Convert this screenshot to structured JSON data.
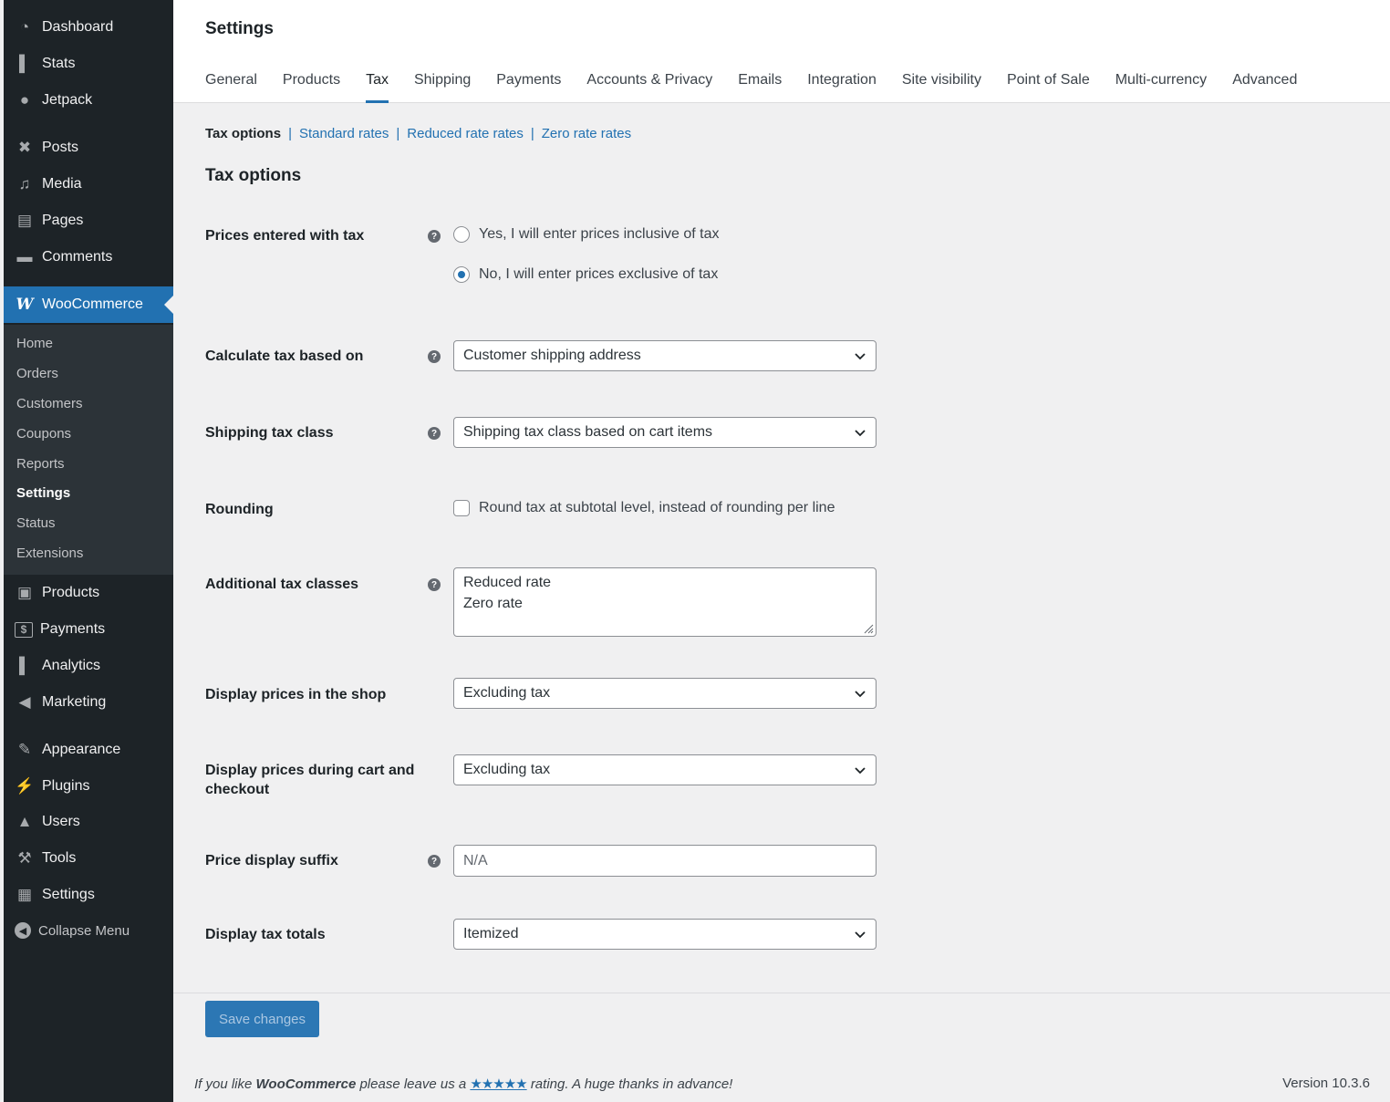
{
  "sidebar": {
    "items": [
      {
        "label": "Dashboard",
        "icon": "dashboard-icon",
        "glyph": "◔"
      },
      {
        "label": "Stats",
        "icon": "stats-icon",
        "glyph": "▌"
      },
      {
        "label": "Jetpack",
        "icon": "jetpack-icon",
        "glyph": "●"
      },
      {
        "label": "Posts",
        "icon": "pin-icon",
        "glyph": "✖"
      },
      {
        "label": "Media",
        "icon": "media-icon",
        "glyph": "♫"
      },
      {
        "label": "Pages",
        "icon": "pages-icon",
        "glyph": "▤"
      },
      {
        "label": "Comments",
        "icon": "comments-icon",
        "glyph": "▬"
      },
      {
        "label": "WooCommerce",
        "icon": "woocommerce-icon",
        "glyph": "W"
      },
      {
        "label": "Products",
        "icon": "archive-icon",
        "glyph": "▣"
      },
      {
        "label": "Payments",
        "icon": "money-icon",
        "glyph": "$"
      },
      {
        "label": "Analytics",
        "icon": "analytics-icon",
        "glyph": "▌"
      },
      {
        "label": "Marketing",
        "icon": "megaphone-icon",
        "glyph": "◀"
      },
      {
        "label": "Appearance",
        "icon": "brush-icon",
        "glyph": "✎"
      },
      {
        "label": "Plugins",
        "icon": "plugin-icon",
        "glyph": "⚡"
      },
      {
        "label": "Users",
        "icon": "users-icon",
        "glyph": "▲"
      },
      {
        "label": "Tools",
        "icon": "wrench-icon",
        "glyph": "⚒"
      },
      {
        "label": "Settings",
        "icon": "settings-icon",
        "glyph": "▦"
      },
      {
        "label": "Collapse Menu",
        "icon": "collapse-icon",
        "glyph": "◀"
      }
    ],
    "submenu": [
      "Home",
      "Orders",
      "Customers",
      "Coupons",
      "Reports",
      "Settings",
      "Status",
      "Extensions"
    ]
  },
  "header": {
    "title": "Settings",
    "tabs": [
      "General",
      "Products",
      "Tax",
      "Shipping",
      "Payments",
      "Accounts & Privacy",
      "Emails",
      "Integration",
      "Site visibility",
      "Point of Sale",
      "Multi-currency",
      "Advanced"
    ],
    "current_tab": "Tax"
  },
  "subnav": {
    "current": "Tax options",
    "sep": "|",
    "links": [
      "Standard rates",
      "Reduced rate rates",
      "Zero rate rates"
    ]
  },
  "section_title": "Tax options",
  "fields": {
    "prices_entered": {
      "label": "Prices entered with tax",
      "options": [
        "Yes, I will enter prices inclusive of tax",
        "No, I will enter prices exclusive of tax"
      ],
      "selected_index": 1
    },
    "calculate_based_on": {
      "label": "Calculate tax based on",
      "value": "Customer shipping address"
    },
    "shipping_tax_class": {
      "label": "Shipping tax class",
      "value": "Shipping tax class based on cart items"
    },
    "rounding": {
      "label": "Rounding",
      "checkbox_label": "Round tax at subtotal level, instead of rounding per line",
      "checked": false
    },
    "additional_classes": {
      "label": "Additional tax classes",
      "lines": [
        "Reduced rate",
        "Zero rate"
      ]
    },
    "display_shop": {
      "label": "Display prices in the shop",
      "value": "Excluding tax"
    },
    "display_cart": {
      "label": "Display prices during cart and checkout",
      "value": "Excluding tax"
    },
    "price_suffix": {
      "label": "Price display suffix",
      "placeholder": "N/A"
    },
    "display_totals": {
      "label": "Display tax totals",
      "value": "Itemized"
    }
  },
  "help_glyph": "?",
  "save_button": "Save changes",
  "footer": {
    "prefix": "If you like",
    "brand": "WooCommerce",
    "middle": "please leave us a",
    "stars": "★★★★★",
    "suffix": "rating. A huge thanks in advance!",
    "version": "Version 10.3.6"
  },
  "colors": {
    "accent": "#2271b1",
    "sidebar_bg": "#1d2327",
    "submenu_bg": "#2c3338"
  }
}
